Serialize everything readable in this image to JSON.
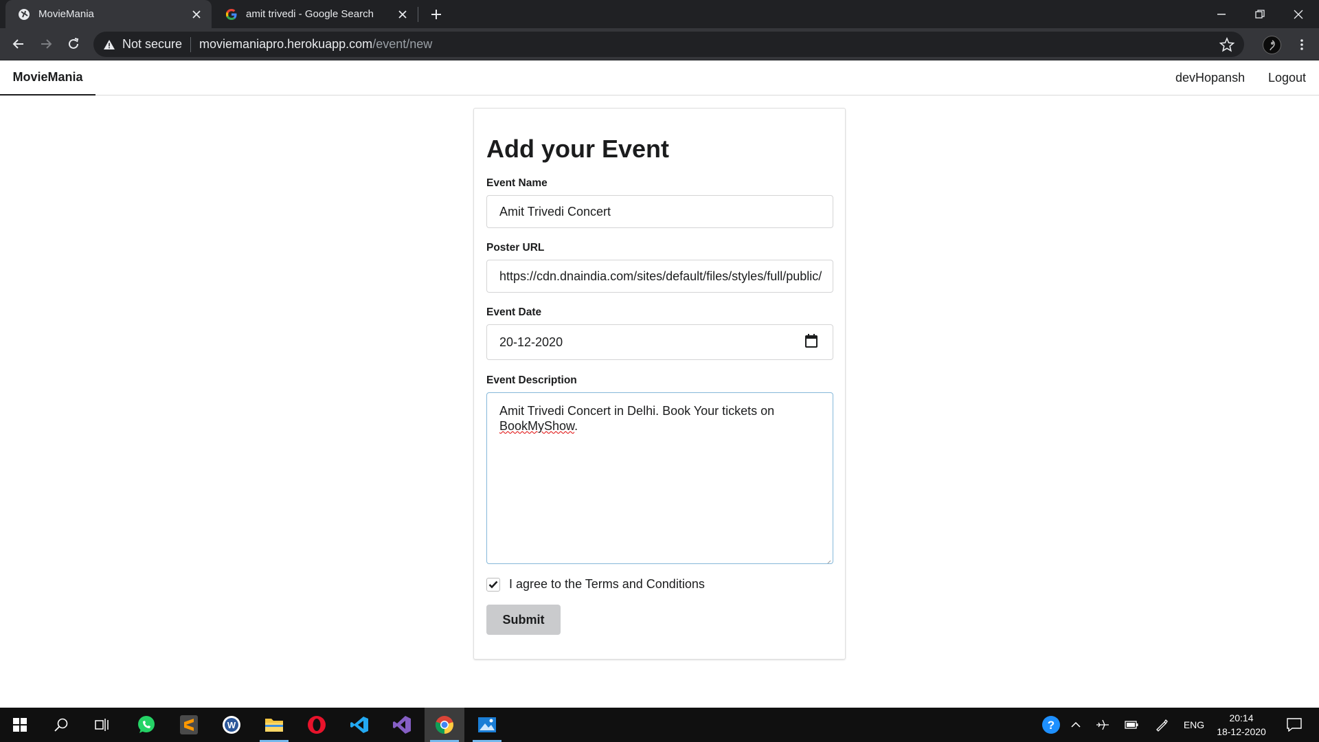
{
  "browser": {
    "tabs": [
      {
        "title": "MovieMania",
        "active": true
      },
      {
        "title": "amit trivedi - Google Search",
        "active": false
      }
    ],
    "address": {
      "security_label": "Not secure",
      "host": "moviemaniapro.herokuapp.com",
      "path": "/event/new"
    }
  },
  "site": {
    "brand": "MovieMania",
    "user": "devHopansh",
    "logout": "Logout"
  },
  "form": {
    "title": "Add your Event",
    "event_name": {
      "label": "Event Name",
      "value": "Amit Trivedi Concert"
    },
    "poster_url": {
      "label": "Poster URL",
      "value": "https://cdn.dnaindia.com/sites/default/files/styles/full/public/"
    },
    "event_date": {
      "label": "Event Date",
      "value": "20-12-2020"
    },
    "event_description": {
      "label": "Event Description",
      "value_part1": "Amit Trivedi Concert in Delhi. Book Your tickets on ",
      "value_misspelled": "BookMyShow",
      "value_part2": "."
    },
    "terms": {
      "label": "I agree to the Terms and Conditions",
      "checked": true
    },
    "submit": "Submit"
  },
  "taskbar": {
    "apps": [
      "start-icon",
      "search-icon",
      "task-view-icon",
      "whatsapp-icon",
      "sublime-text-icon",
      "word-icon",
      "file-explorer-icon",
      "opera-icon",
      "vscode-icon",
      "visual-studio-icon",
      "chrome-icon",
      "photos-icon"
    ],
    "language": "ENG",
    "time": "20:14",
    "date": "18-12-2020"
  }
}
